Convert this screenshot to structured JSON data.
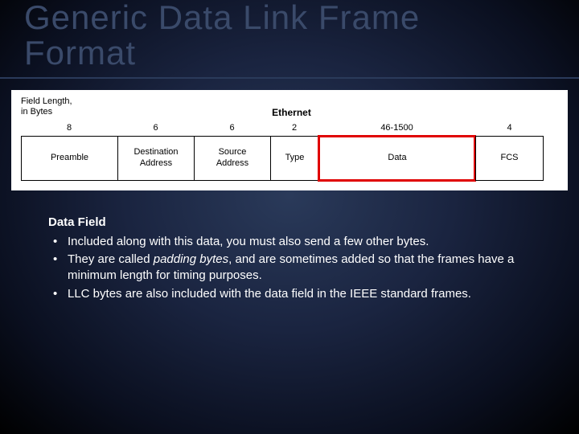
{
  "title_line1": "Generic Data Link Frame",
  "title_line2": "Format",
  "diagram": {
    "field_length_label": "Field Length,\nin Bytes",
    "protocol_label": "Ethernet",
    "columns": [
      {
        "length": "8",
        "name": "Preamble"
      },
      {
        "length": "6",
        "name": "Destination\nAddress"
      },
      {
        "length": "6",
        "name": "Source\nAddress"
      },
      {
        "length": "2",
        "name": "Type"
      },
      {
        "length": "46-1500",
        "name": "Data"
      },
      {
        "length": "4",
        "name": "FCS"
      }
    ],
    "highlighted_field": "Data"
  },
  "section_heading": "Data Field",
  "bullets": [
    "Included along with this data, you must also send a few other bytes.",
    "They are called padding bytes, and are sometimes added so that the frames have a minimum length for timing purposes.",
    "LLC bytes are also included with the data field in the IEEE standard frames."
  ],
  "italic_phrase": "padding bytes"
}
